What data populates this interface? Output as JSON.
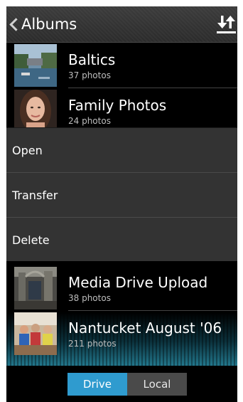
{
  "header": {
    "title": "Albums"
  },
  "albums": [
    {
      "title": "Baltics",
      "count": "37 photos",
      "thumb": "canal-photo"
    },
    {
      "title": "Family Photos",
      "count": "24 photos",
      "thumb": "portrait-photo"
    },
    {
      "title": "Media Drive Upload",
      "count": "38 photos",
      "thumb": "church-photo"
    },
    {
      "title": "Nantucket August '06",
      "count": "211 photos",
      "thumb": "kids-photo"
    }
  ],
  "context_menu": [
    {
      "label": "Open"
    },
    {
      "label": "Transfer"
    },
    {
      "label": "Delete"
    }
  ],
  "footer": {
    "drive_label": "Drive",
    "local_label": "Local",
    "selected": "Drive"
  },
  "colors": {
    "accent": "#2f9bcf",
    "menu_bg": "#333333",
    "background": "#000000"
  }
}
